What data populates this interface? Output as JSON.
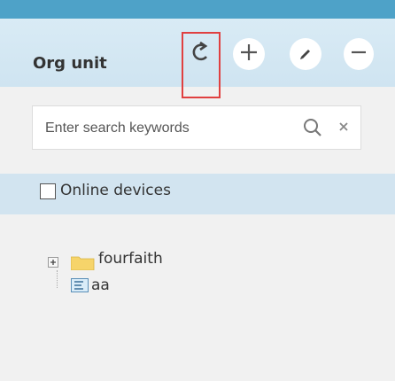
{
  "panel": {
    "title": "Org unit",
    "toolbar": {
      "refresh_icon": "refresh-icon",
      "add_icon": "plus-icon",
      "edit_icon": "pencil-icon",
      "remove_icon": "minus-icon"
    },
    "search": {
      "placeholder": "Enter search keywords",
      "value": "",
      "search_icon": "search-icon",
      "clear_icon": "close-icon"
    },
    "filter": {
      "label": "Online devices",
      "checked": false
    },
    "tree": [
      {
        "label": "fourfaith",
        "type": "folder",
        "expand_icon": "expand-plus-icon",
        "icon": "folder-icon"
      },
      {
        "label": "aa",
        "type": "device",
        "icon": "device-list-icon"
      }
    ]
  },
  "colors": {
    "top_bar": "#4ea2c8",
    "header_bg": "#d4e7f3",
    "highlight_border": "#e04040"
  }
}
